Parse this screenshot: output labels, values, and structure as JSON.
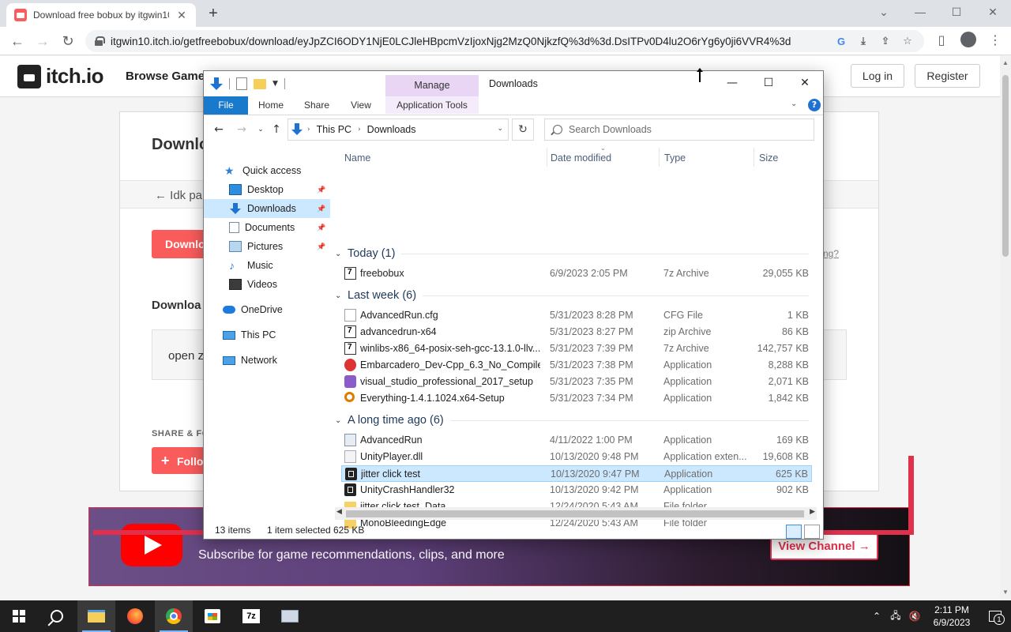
{
  "browser": {
    "tab_title": "Download free bobux by itgwin10",
    "tab_close": "✕",
    "new_tab": "+",
    "url": "itgwin10.itch.io/getfreebobux/download/eyJpZCI6ODY1NjE0LCJleHBpcmVzIjoxNjg2MzQ0NjkzfQ%3d%3d.DsITPv0D4lu2O6rYg6y0ji6VVR4%3d",
    "controls": {
      "minimize": "—",
      "maximize": "☐",
      "close": "✕",
      "tab_search": "⌄"
    },
    "nav": {
      "back": "←",
      "forward": "→",
      "reload": "↻"
    }
  },
  "page": {
    "logo_text": "itch.io",
    "browse": "Browse Games",
    "login": "Log in",
    "register": "Register",
    "card_title": "Downlo",
    "back_text": "← Idk pa",
    "download_button": "Downlo",
    "help_link": "rting?",
    "download_section": "Downloa",
    "file_box_text": "open z",
    "share_label": "SHARE & FO",
    "follow_button": "Follo",
    "follow_plus": "+",
    "yt_subscribe": "Subscribe for game recommendations, clips, and more",
    "yt_channel_button": "View Channel →"
  },
  "explorer": {
    "title": "Downloads",
    "manage_tab": "Manage",
    "ribbon_tabs": {
      "file": "File",
      "home": "Home",
      "share": "Share",
      "view": "View",
      "app_tools": "Application Tools"
    },
    "controls": {
      "minimize": "—",
      "maximize": "☐",
      "close": "✕"
    },
    "help": "?",
    "breadcrumb": [
      "This PC",
      "Downloads"
    ],
    "search_placeholder": "Search Downloads",
    "nav": [
      {
        "label": "Quick access",
        "icon": "star-icon"
      },
      {
        "label": "Desktop",
        "icon": "desktop-icon",
        "pinned": true
      },
      {
        "label": "Downloads",
        "icon": "download-icon",
        "pinned": true,
        "selected": true
      },
      {
        "label": "Documents",
        "icon": "document-icon",
        "pinned": true
      },
      {
        "label": "Pictures",
        "icon": "pictures-icon",
        "pinned": true
      },
      {
        "label": "Music",
        "icon": "music-icon"
      },
      {
        "label": "Videos",
        "icon": "videos-icon"
      },
      {
        "label": "OneDrive",
        "icon": "cloud-icon"
      },
      {
        "label": "This PC",
        "icon": "pc-icon"
      },
      {
        "label": "Network",
        "icon": "network-icon"
      }
    ],
    "columns": {
      "name": "Name",
      "date": "Date modified",
      "type": "Type",
      "size": "Size"
    },
    "groups": [
      {
        "title": "Today (1)",
        "files": [
          {
            "name": "freebobux",
            "date": "6/9/2023 2:05 PM",
            "type": "7z Archive",
            "size": "29,055 KB",
            "icon": "7z-archive-icon"
          }
        ]
      },
      {
        "title": "Last week (6)",
        "files": [
          {
            "name": "AdvancedRun.cfg",
            "date": "5/31/2023 8:28 PM",
            "type": "CFG File",
            "size": "1 KB",
            "icon": "cfg-file-icon"
          },
          {
            "name": "advancedrun-x64",
            "date": "5/31/2023 8:27 PM",
            "type": "zip Archive",
            "size": "86 KB",
            "icon": "zip-archive-icon"
          },
          {
            "name": "winlibs-x86_64-posix-seh-gcc-13.1.0-llv...",
            "date": "5/31/2023 7:39 PM",
            "type": "7z Archive",
            "size": "142,757 KB",
            "icon": "7z-archive-icon"
          },
          {
            "name": "Embarcadero_Dev-Cpp_6.3_No_Compiler...",
            "date": "5/31/2023 7:38 PM",
            "type": "Application",
            "size": "8,288 KB",
            "icon": "devcpp-icon"
          },
          {
            "name": "visual_studio_professional_2017_setup",
            "date": "5/31/2023 7:35 PM",
            "type": "Application",
            "size": "2,071 KB",
            "icon": "visual-studio-icon"
          },
          {
            "name": "Everything-1.4.1.1024.x64-Setup",
            "date": "5/31/2023 7:34 PM",
            "type": "Application",
            "size": "1,842 KB",
            "icon": "everything-icon"
          }
        ]
      },
      {
        "title": "A long time ago (6)",
        "files": [
          {
            "name": "AdvancedRun",
            "date": "4/11/2022 1:00 PM",
            "type": "Application",
            "size": "169 KB",
            "icon": "application-icon"
          },
          {
            "name": "UnityPlayer.dll",
            "date": "10/13/2020 9:48 PM",
            "type": "Application exten...",
            "size": "19,608 KB",
            "icon": "dll-icon"
          },
          {
            "name": "jitter click test",
            "date": "10/13/2020 9:47 PM",
            "type": "Application",
            "size": "625 KB",
            "icon": "unity-icon",
            "selected": true
          },
          {
            "name": "UnityCrashHandler32",
            "date": "10/13/2020 9:42 PM",
            "type": "Application",
            "size": "902 KB",
            "icon": "unity-icon"
          },
          {
            "name": "jitter click test_Data",
            "date": "12/24/2020 5:43 AM",
            "type": "File folder",
            "size": "",
            "icon": "folder-icon"
          },
          {
            "name": "MonoBleedingEdge",
            "date": "12/24/2020 5:43 AM",
            "type": "File folder",
            "size": "",
            "icon": "folder-icon"
          }
        ]
      }
    ],
    "status": {
      "items": "13 items",
      "selected": "1 item selected",
      "selected_size": "625 KB"
    }
  },
  "taskbar": {
    "apps": [
      "start-icon",
      "search-icon",
      "file-explorer-icon",
      "firefox-icon",
      "chrome-icon",
      "store-icon",
      "7zip-icon",
      "advancedrun-icon"
    ],
    "seven_zip_label": "7z",
    "time": "2:11 PM",
    "date": "6/9/2023",
    "notification_count": "1",
    "tray_up": "⌃"
  }
}
